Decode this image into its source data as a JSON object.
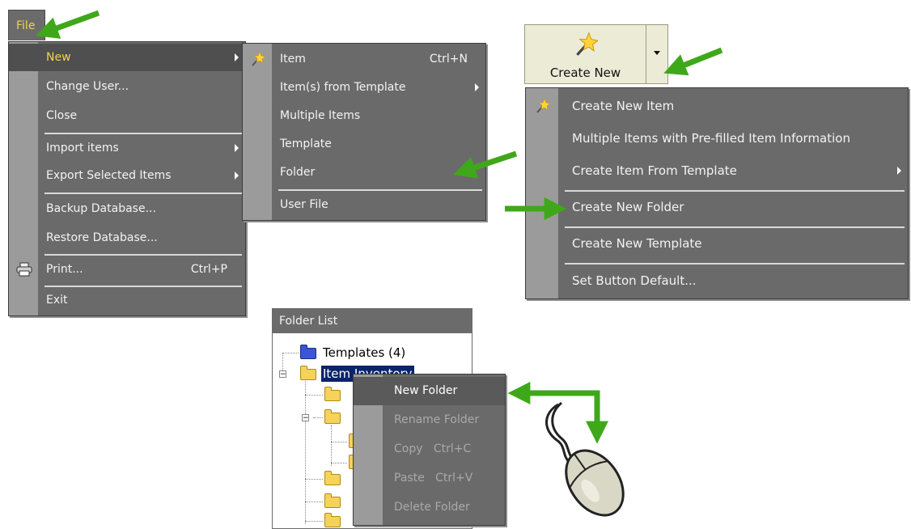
{
  "file_menu": {
    "tab_label": "File",
    "items": [
      {
        "label": "New",
        "highlighted": true,
        "submenu": true
      },
      {
        "label": "Change User..."
      },
      {
        "label": "Close"
      },
      {
        "label": "Import items",
        "submenu": true
      },
      {
        "label": "Export Selected Items",
        "submenu": true
      },
      {
        "label": "Backup Database..."
      },
      {
        "label": "Restore Database..."
      },
      {
        "label": "Print...",
        "shortcut": "Ctrl+P",
        "icon": "printer-icon"
      },
      {
        "label": "Exit"
      }
    ]
  },
  "new_submenu": {
    "items": [
      {
        "label": "Item",
        "shortcut": "Ctrl+N",
        "icon": "magic-wand-icon"
      },
      {
        "label": "Item(s) from Template",
        "submenu": true
      },
      {
        "label": "Multiple Items"
      },
      {
        "label": "Template"
      },
      {
        "label": "Folder"
      },
      {
        "label": "User File"
      }
    ]
  },
  "create_button": {
    "label": "Create New",
    "icon": "magic-wand-icon"
  },
  "create_menu": {
    "items": [
      {
        "label": "Create New Item",
        "icon": "magic-wand-icon"
      },
      {
        "label": "Multiple Items with Pre-filled Item Information"
      },
      {
        "label": "Create Item From Template",
        "submenu": true
      },
      {
        "label": "Create New Folder"
      },
      {
        "label": "Create New Template"
      },
      {
        "label": "Set Button Default..."
      }
    ]
  },
  "folder_list": {
    "title": "Folder List",
    "nodes": [
      {
        "label": "Templates (4)",
        "color": "blue"
      },
      {
        "label": "Item Inventory",
        "selected": true
      }
    ]
  },
  "context_menu": {
    "items": [
      {
        "label": "New Folder",
        "enabled": true
      },
      {
        "label": "Rename Folder",
        "enabled": false
      },
      {
        "label": "Copy   Ctrl+C",
        "enabled": false
      },
      {
        "label": "Paste   Ctrl+V",
        "enabled": false
      },
      {
        "label": "Delete Folder",
        "enabled": false
      }
    ]
  },
  "colors": {
    "menu_bg": "#6a6a6a",
    "menu_strip": "#9b9b9b",
    "highlight_text": "#f2d34a",
    "arrow_green": "#3fa81a",
    "button_bg": "#ebebd6",
    "selection_bg": "#0a246a"
  }
}
